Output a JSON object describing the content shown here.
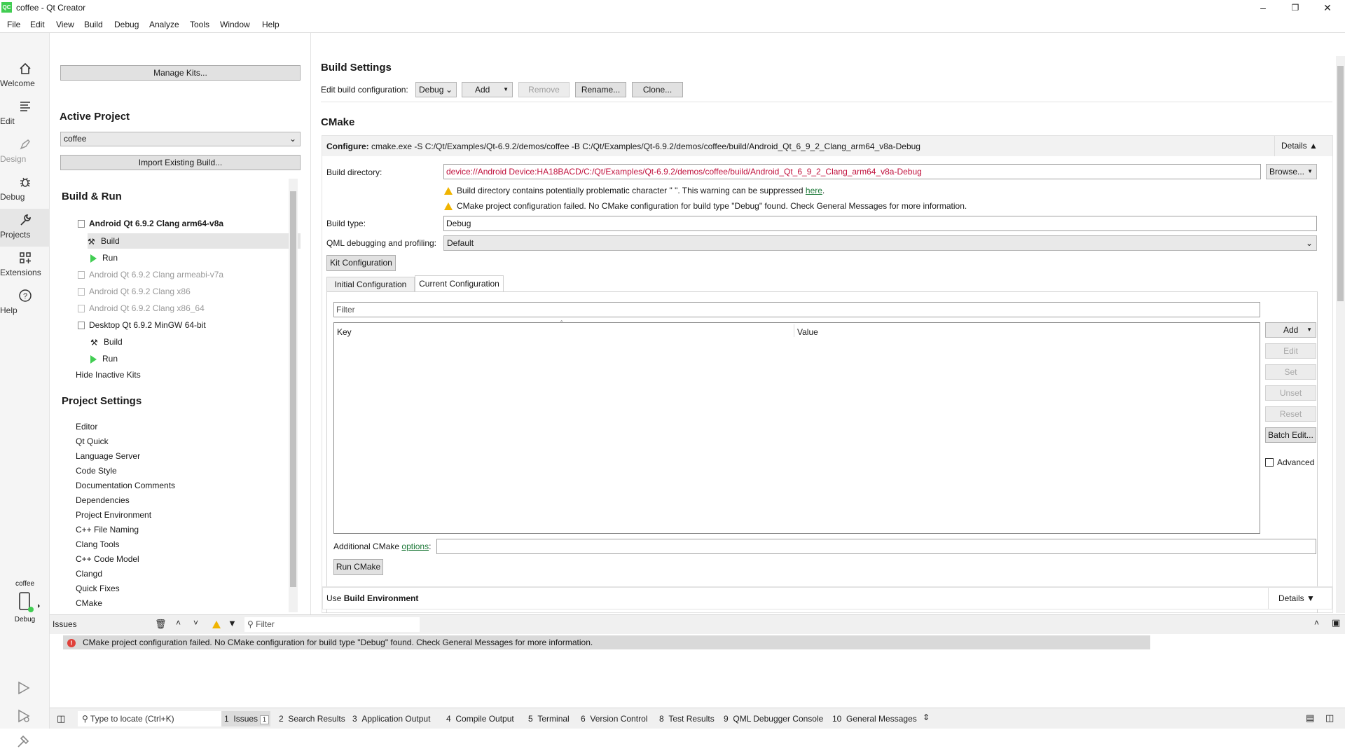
{
  "window": {
    "title": "coffee - Qt Creator",
    "app_icon": "QC"
  },
  "menu": [
    "File",
    "Edit",
    "View",
    "Build",
    "Debug",
    "Analyze",
    "Tools",
    "Window",
    "Help"
  ],
  "modes": [
    {
      "label": "Welcome",
      "icon": "home-icon"
    },
    {
      "label": "Edit",
      "icon": "edit-icon"
    },
    {
      "label": "Design",
      "icon": "design-icon"
    },
    {
      "label": "Debug",
      "icon": "bug-icon"
    },
    {
      "label": "Projects",
      "icon": "wrench-icon"
    },
    {
      "label": "Extensions",
      "icon": "extensions-icon"
    },
    {
      "label": "Help",
      "icon": "help-icon"
    }
  ],
  "target": {
    "project": "coffee",
    "mode": "Debug"
  },
  "left": {
    "manage_kits": "Manage Kits...",
    "active_project_heading": "Active Project",
    "active_project": "coffee",
    "import_build": "Import Existing Build...",
    "build_run_heading": "Build & Run",
    "kits": [
      {
        "name": "Android Qt 6.9.2 Clang arm64-v8a",
        "state": "active"
      },
      {
        "name": "Build",
        "state": "child-selected"
      },
      {
        "name": "Run",
        "state": "child"
      },
      {
        "name": "Android Qt 6.9.2 Clang armeabi-v7a",
        "state": "inactive"
      },
      {
        "name": "Android Qt 6.9.2 Clang x86",
        "state": "inactive"
      },
      {
        "name": "Android Qt 6.9.2 Clang x86_64",
        "state": "inactive"
      },
      {
        "name": "Desktop Qt 6.9.2 MinGW 64-bit",
        "state": "normal"
      },
      {
        "name": "Build",
        "state": "child"
      },
      {
        "name": "Run",
        "state": "child"
      }
    ],
    "hide_inactive": "Hide Inactive Kits",
    "project_settings_heading": "Project Settings",
    "project_settings": [
      "Editor",
      "Qt Quick",
      "Language Server",
      "Code Style",
      "Documentation Comments",
      "Dependencies",
      "Project Environment",
      "C++ File Naming",
      "Clang Tools",
      "C++ Code Model",
      "Clangd",
      "Quick Fixes",
      "CMake"
    ]
  },
  "build": {
    "heading": "Build Settings",
    "edit_config_label": "Edit build configuration:",
    "config": "Debug",
    "add": "Add",
    "remove": "Remove",
    "rename": "Rename...",
    "clone": "Clone...",
    "cmake_heading": "CMake",
    "configure_label": "Configure:",
    "configure_cmd": "cmake.exe -S C:/Qt/Examples/Qt-6.9.2/demos/coffee -B C:/Qt/Examples/Qt-6.9.2/demos/coffee/build/Android_Qt_6_9_2_Clang_arm64_v8a-Debug",
    "details": "Details",
    "build_dir_label": "Build directory:",
    "build_dir": "device://Android Device:HA18BACD/C:/Qt/Examples/Qt-6.9.2/demos/coffee/build/Android_Qt_6_9_2_Clang_arm64_v8a-Debug",
    "browse": "Browse...",
    "warn1": "Build directory contains potentially problematic character \" \". This warning can be suppressed ",
    "warn1_link": "here",
    "warn2": "CMake project configuration failed. No CMake configuration for build type \"Debug\" found. Check General Messages for more information.",
    "build_type_label": "Build type:",
    "build_type": "Debug",
    "qml_label": "QML debugging and profiling:",
    "qml_value": "Default",
    "kit_config": "Kit Configuration",
    "tab_initial": "Initial Configuration",
    "tab_current": "Current Configuration",
    "filter_placeholder": "Filter",
    "col_key": "Key",
    "col_value": "Value",
    "side_buttons": [
      "Add",
      "Edit",
      "Set",
      "Unset",
      "Reset",
      "Batch Edit..."
    ],
    "advanced": "Advanced",
    "additional_label": "Additional CMake ",
    "additional_link": "options",
    "run_cmake": "Run CMake",
    "use_env_prefix": "Use ",
    "use_env_bold": "Build Environment",
    "details2": "Details"
  },
  "issues": {
    "title": "Issues",
    "filter_placeholder": "Filter",
    "message": "CMake project configuration failed. No CMake configuration for build type \"Debug\" found. Check General Messages for more information."
  },
  "status": {
    "locate_placeholder": "Type to locate (Ctrl+K)",
    "panes": [
      {
        "num": "1",
        "label": "Issues",
        "badge": "1"
      },
      {
        "num": "2",
        "label": "Search Results"
      },
      {
        "num": "3",
        "label": "Application Output"
      },
      {
        "num": "4",
        "label": "Compile Output"
      },
      {
        "num": "5",
        "label": "Terminal"
      },
      {
        "num": "6",
        "label": "Version Control"
      },
      {
        "num": "8",
        "label": "Test Results"
      },
      {
        "num": "9",
        "label": "QML Debugger Console"
      },
      {
        "num": "10",
        "label": "General Messages"
      }
    ]
  }
}
